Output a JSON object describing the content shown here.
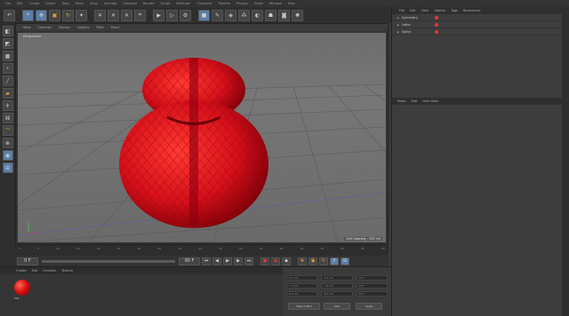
{
  "menubar": {
    "items": [
      "File",
      "Edit",
      "Create",
      "Select",
      "Tools",
      "Mesh",
      "Snap",
      "Animate",
      "Simulate",
      "Render",
      "Sculpt",
      "MoGraph",
      "Character",
      "Pipeline",
      "Plugins",
      "Script",
      "Window",
      "Help"
    ]
  },
  "toolbar": {
    "buttons": [
      "undo",
      "redo",
      "live-select",
      "move",
      "scale",
      "rotate",
      "last-tool",
      "x-axis",
      "y-axis",
      "z-axis",
      "coord-system",
      "render-view",
      "render-picture",
      "edit-render-settings",
      "cube",
      "spline",
      "nurbs",
      "array",
      "deformer",
      "scene",
      "camera",
      "light"
    ]
  },
  "left_tools": {
    "buttons": [
      "model",
      "texture",
      "workplane",
      "points",
      "edges",
      "polygons",
      "axis",
      "tweak",
      "snap",
      "enable-axis",
      "viewport-solo",
      "lock"
    ]
  },
  "viewport": {
    "menu": [
      "View",
      "Cameras",
      "Display",
      "Options",
      "Filter",
      "Panel"
    ],
    "camera_label": "Perspective",
    "dims": "Grid Spacing : 100 cm"
  },
  "timeline": {
    "ticks": [
      "0",
      "5",
      "10",
      "15",
      "20",
      "25",
      "30",
      "35",
      "40",
      "45",
      "50",
      "55",
      "60",
      "65",
      "70",
      "75",
      "80",
      "85",
      "90"
    ],
    "end": "90 F"
  },
  "transport": {
    "frame_start": "0 F",
    "frame_end": "90 F"
  },
  "materials": {
    "tabs": [
      "Create",
      "Edit",
      "Function",
      "Texture"
    ],
    "item_label": "Mat"
  },
  "coordinates": {
    "rows": [
      [
        "X 0 cm",
        "X 0 cm",
        "H 0°"
      ],
      [
        "Y 0 cm",
        "Y 0 cm",
        "P 0°"
      ],
      [
        "Z 0 cm",
        "Z 0 cm",
        "B 0°"
      ]
    ],
    "mode": "Object (Rel)",
    "size": "Size",
    "apply": "Apply"
  },
  "objects_panel": {
    "tabs": [
      "File",
      "Edit",
      "View",
      "Objects",
      "Tags",
      "Bookmarks"
    ],
    "items": [
      {
        "name": "Symmetry"
      },
      {
        "name": "Lathe"
      },
      {
        "name": "Spline"
      }
    ]
  },
  "attributes_panel": {
    "tabs": [
      "Mode",
      "Edit",
      "User Data"
    ]
  },
  "colors": {
    "accent": "#e03030",
    "selected": "#5a7fa8"
  }
}
